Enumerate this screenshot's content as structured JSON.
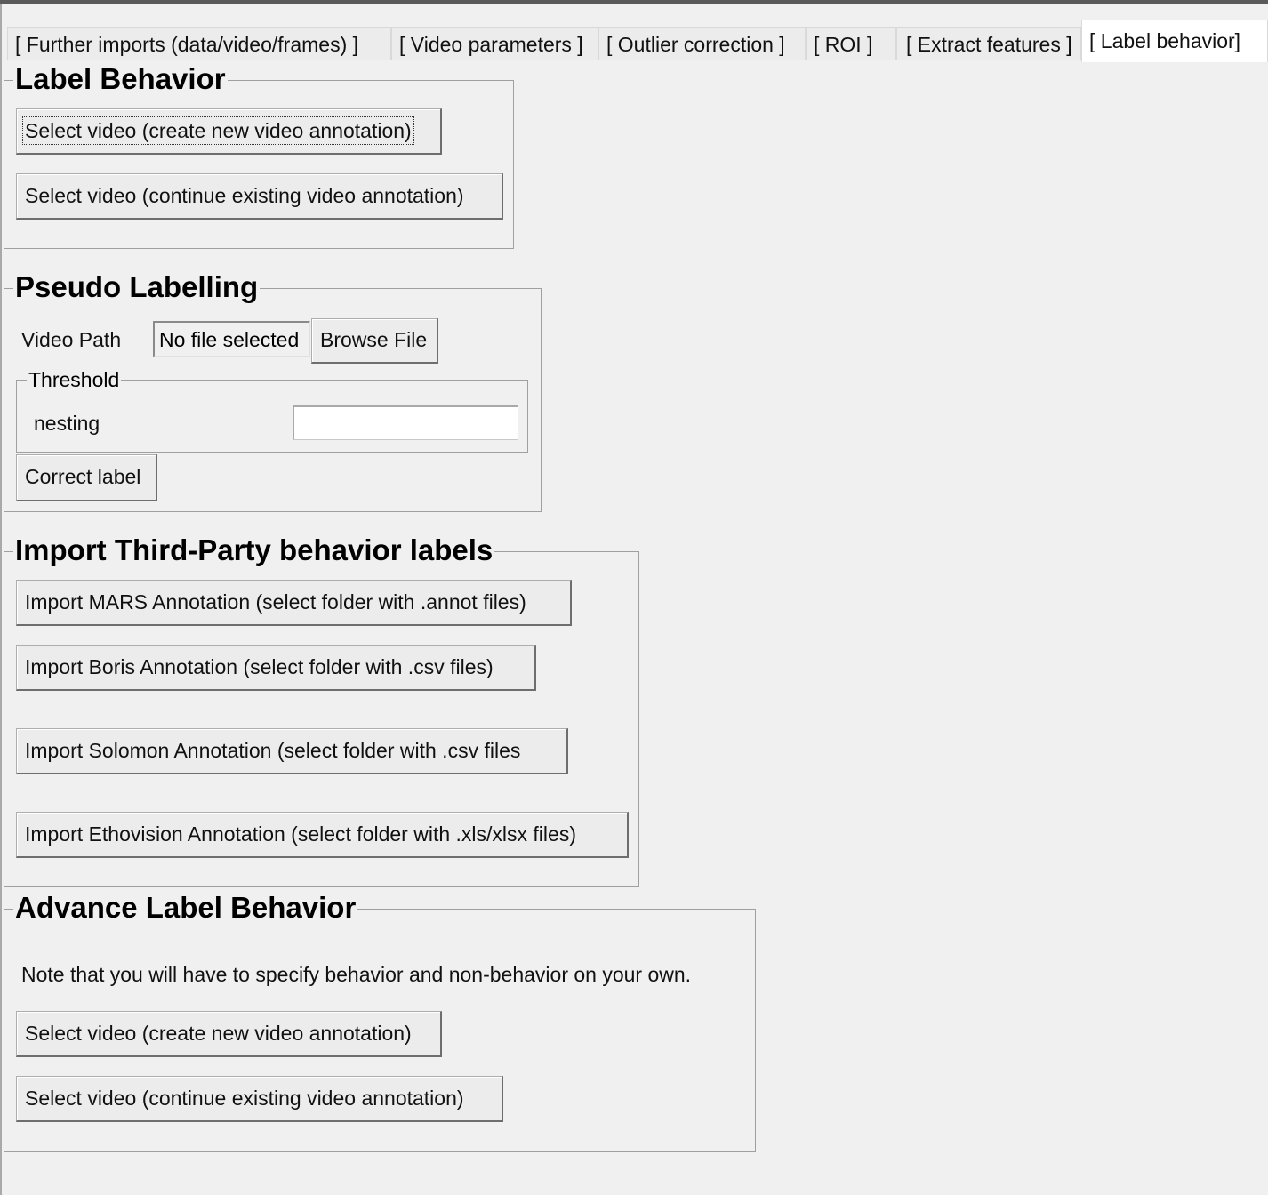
{
  "tabs": [
    {
      "label": "[ Further imports (data/video/frames) ]",
      "active": false
    },
    {
      "label": "[ Video parameters ]",
      "active": false
    },
    {
      "label": "[ Outlier correction ]",
      "active": false
    },
    {
      "label": "[ ROI ]",
      "active": false
    },
    {
      "label": "[ Extract features ]",
      "active": false
    },
    {
      "label": "[ Label behavior]",
      "active": true
    }
  ],
  "label_behavior": {
    "title": "Label Behavior",
    "btn_new": "Select video (create new video annotation)",
    "btn_continue": "Select video (continue existing video annotation)"
  },
  "pseudo_labelling": {
    "title": "Pseudo Labelling",
    "video_path_label": "Video Path",
    "file_value": "No file selected",
    "browse_button": "Browse File",
    "threshold_title": "Threshold",
    "nesting_label": "nesting",
    "nesting_value": "",
    "correct_button": "Correct label"
  },
  "import_third_party": {
    "title": "Import Third-Party behavior labels",
    "btn_mars": "Import MARS Annotation (select folder with .annot files)",
    "btn_boris": "Import Boris Annotation (select folder with .csv files)",
    "btn_solomon": "Import Solomon Annotation (select folder with .csv files",
    "btn_ethovision": "Import Ethovision Annotation (select folder with .xls/xlsx files)"
  },
  "advance_label_behavior": {
    "title": "Advance Label Behavior",
    "note": "Note that you will have to specify behavior and non-behavior on your own.",
    "btn_new": "Select video (create new video annotation)",
    "btn_continue": "Select video (continue existing video annotation)"
  }
}
